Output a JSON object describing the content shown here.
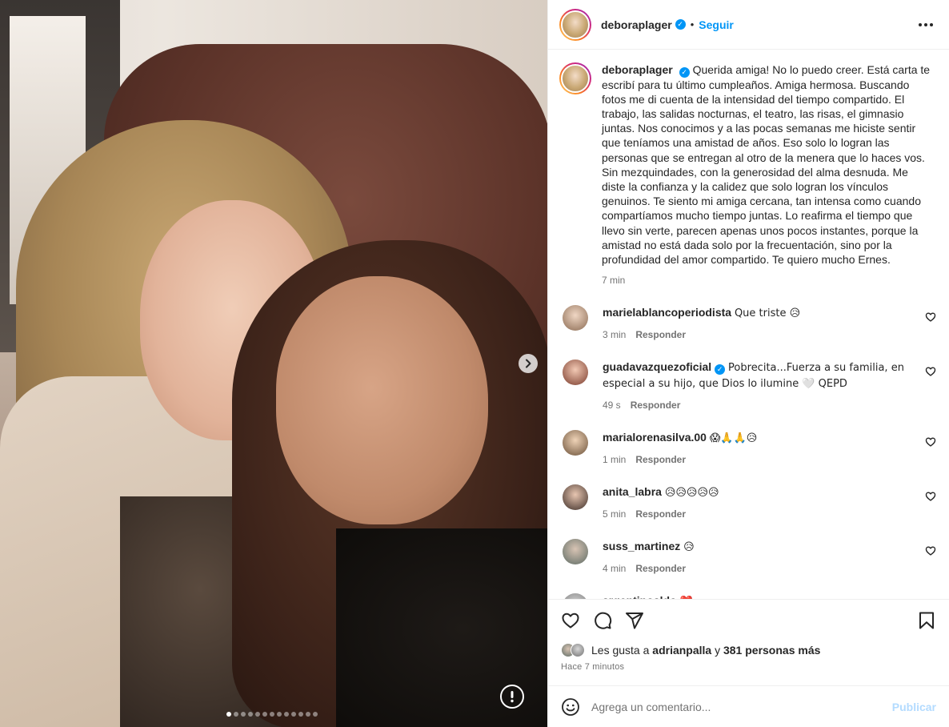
{
  "post": {
    "author": "deboraplager",
    "follow_label": "Seguir",
    "separator": "•",
    "caption": "Querida amiga! No lo puedo creer. Está carta te escribí para tu último cumpleaños. Amiga hermosa. Buscando fotos me di cuenta de la intensidad del tiempo compartido. El trabajo, las salidas nocturnas, el teatro, las risas, el gimnasio juntas. Nos conocimos y a las pocas semanas me hiciste sentir que teníamos una amistad de años. Eso solo lo logran las personas que se entregan al otro de la menera que lo haces vos. Sin mezquindades, con la generosidad del alma desnuda. Me diste la confianza y la calidez que solo logran los vínculos genuinos. Te siento mi amiga cercana, tan intensa como cuando compartíamos mucho tiempo juntas. Lo reafirma el tiempo que llevo sin verte, parecen apenas unos pocos instantes, porque la amistad no está dada solo por la frecuentación, sino por la profundidad del amor compartido. Te quiero mucho Ernes.",
    "caption_time": "7 min"
  },
  "comments": [
    {
      "user": "marielablancoperiodista",
      "text": "Que triste 😥",
      "time": "3 min",
      "reply": "Responder",
      "verified": false
    },
    {
      "user": "guadavazquezoficial",
      "text": "Pobrecita...Fuerza a su familia, en especial a su hijo, que Dios lo ilumine 🤍 QEPD",
      "time": "49 s",
      "reply": "Responder",
      "verified": true
    },
    {
      "user": "marialorenasilva.00",
      "text": "😱🙏🙏😥",
      "time": "1 min",
      "reply": "Responder",
      "verified": false
    },
    {
      "user": "anita_labra",
      "text": "😥😥😥😥😥",
      "time": "5 min",
      "reply": "Responder",
      "verified": false
    },
    {
      "user": "suss_martinez",
      "text": "😥",
      "time": "4 min",
      "reply": "Responder",
      "verified": false
    },
    {
      "user": "argentinoaldo",
      "text": "❤️",
      "time": "",
      "reply": "",
      "verified": false
    }
  ],
  "likes": {
    "prefix": "Les gusta a",
    "first_user": "adrianpalla",
    "connector": "y",
    "others": "381 personas más"
  },
  "posted_ago": "Hace 7 minutos",
  "add_comment": {
    "placeholder": "Agrega un comentario...",
    "publish_label": "Publicar"
  },
  "carousel": {
    "slides": 13,
    "current": 1
  },
  "colors": {
    "accent": "#0095f6",
    "publish_disabled": "#b3dbff",
    "muted": "#737373"
  }
}
